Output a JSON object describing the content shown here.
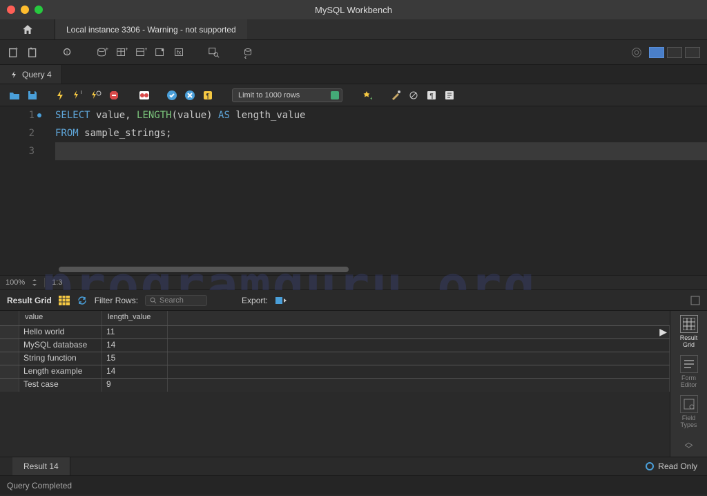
{
  "window": {
    "title": "MySQL Workbench"
  },
  "connection_tab": "Local instance 3306 - Warning - not supported",
  "query_tab": "Query 4",
  "limit_rows": "Limit to 1000 rows",
  "sql": {
    "line1_pre": "SELECT",
    "line1_mid": " value, ",
    "line1_fn": "LENGTH",
    "line1_post": "(value) ",
    "line1_as": "AS",
    "line1_end": " length_value",
    "line2_pre": "FROM",
    "line2_post": " sample_strings;"
  },
  "editor_status": {
    "zoom": "100%",
    "cursor": "1:3"
  },
  "result_toolbar": {
    "label": "Result Grid",
    "filter_label": "Filter Rows:",
    "search_placeholder": "Search",
    "export_label": "Export:"
  },
  "columns": [
    "value",
    "length_value"
  ],
  "rows": [
    {
      "value": "Hello world",
      "length_value": "11"
    },
    {
      "value": "MySQL database",
      "length_value": "14"
    },
    {
      "value": "String function",
      "length_value": "15"
    },
    {
      "value": "Length example",
      "length_value": "14"
    },
    {
      "value": "Test case",
      "length_value": "9"
    }
  ],
  "side_panel": {
    "result_grid": "Result\nGrid",
    "form_editor": "Form\nEditor",
    "field_types": "Field\nTypes"
  },
  "bottom_tab": "Result 14",
  "read_only": "Read Only",
  "status": "Query Completed",
  "watermark": "programguru.org"
}
